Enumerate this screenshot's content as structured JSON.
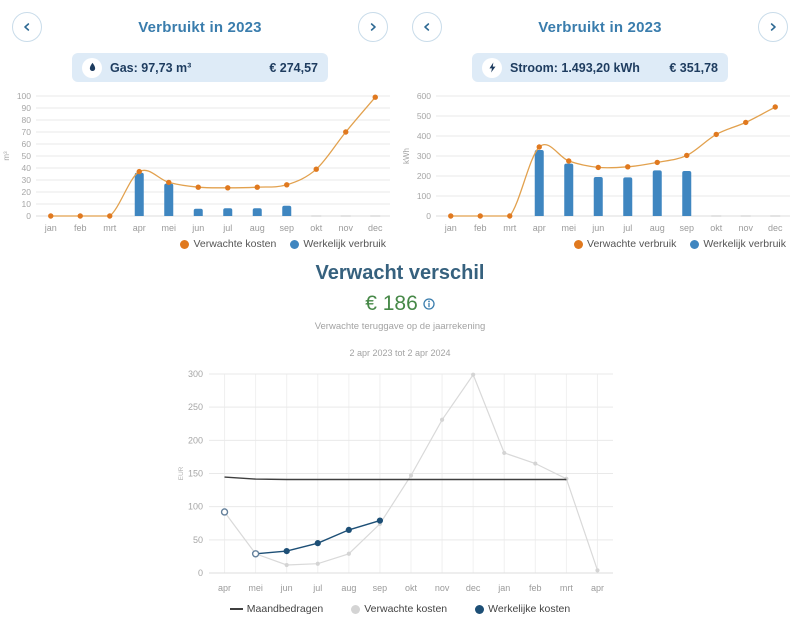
{
  "colors": {
    "accent_blue": "#3a7dad",
    "navy_text": "#1e3c5f",
    "pill_bg": "#deebf7",
    "bar_blue": "#3f86c0",
    "line_orange": "#e2a14e",
    "marker_orange": "#e0791f",
    "green_amount": "#468847",
    "gray_series": "#d9d9d9",
    "navy_series": "#1d4f76",
    "dark_line": "#3f3f3f"
  },
  "gas_panel": {
    "title": "Verbruikt in 2023",
    "pill": {
      "icon": "flame-icon",
      "label": "Gas: 97,73 m³",
      "amount": "€ 274,57"
    },
    "legend": [
      {
        "label": "Verwachte kosten",
        "color": "#e0791f"
      },
      {
        "label": "Werkelijk verbruik",
        "color": "#3f86c0"
      }
    ]
  },
  "stroom_panel": {
    "title": "Verbruikt in 2023",
    "pill": {
      "icon": "lightning-icon",
      "label": "Stroom: 1.493,20 kWh",
      "amount": "€ 351,78"
    },
    "legend": [
      {
        "label": "Verwachte verbruik",
        "color": "#e0791f"
      },
      {
        "label": "Werkelijk verbruik",
        "color": "#3f86c0"
      }
    ]
  },
  "forecast_panel": {
    "title": "Verwacht verschil",
    "amount": "€ 186",
    "subtitle": "Verwachte teruggave op de jaarrekening",
    "date_range": "2 apr 2023 tot 2 apr 2024",
    "legend": [
      {
        "label": "Maandbedragen",
        "color": "#3f3f3f",
        "marker": "line"
      },
      {
        "label": "Verwachte kosten",
        "color": "#d4d4d4",
        "marker": "dot"
      },
      {
        "label": "Werkelijke kosten",
        "color": "#1d4f76",
        "marker": "dot"
      }
    ]
  },
  "chart_data": [
    {
      "id": "gas",
      "type": "bar+line",
      "title": "Gas verbruik 2023",
      "categories": [
        "jan",
        "feb",
        "mrt",
        "apr",
        "mei",
        "jun",
        "jul",
        "aug",
        "sep",
        "okt",
        "nov",
        "dec"
      ],
      "ylabel": "m³",
      "ylim": [
        0,
        100
      ],
      "ystep": 10,
      "grid": true,
      "legend_position": "bottom-right",
      "series": [
        {
          "name": "Verwachte kosten",
          "type": "line",
          "color": "#e2a14e",
          "marker_color": "#e0791f",
          "values": [
            0,
            0,
            0,
            37,
            28,
            24,
            23.5,
            24,
            26,
            39,
            70,
            99
          ]
        },
        {
          "name": "Werkelijk verbruik",
          "type": "bar",
          "color": "#3f86c0",
          "values": [
            0,
            0,
            0,
            36,
            27,
            6,
            6.5,
            6.5,
            8.5,
            null,
            null,
            null
          ]
        }
      ]
    },
    {
      "id": "stroom",
      "type": "bar+line",
      "title": "Stroom verbruik 2023",
      "categories": [
        "jan",
        "feb",
        "mrt",
        "apr",
        "mei",
        "jun",
        "jul",
        "aug",
        "sep",
        "okt",
        "nov",
        "dec"
      ],
      "ylabel": "kWh",
      "ylim": [
        0,
        600
      ],
      "ystep": 100,
      "grid": true,
      "legend_position": "bottom-right",
      "series": [
        {
          "name": "Verwachte verbruik",
          "type": "line",
          "color": "#e2a14e",
          "marker_color": "#e0791f",
          "values": [
            0,
            0,
            0,
            345,
            275,
            243,
            246,
            268,
            303,
            408,
            468,
            545
          ]
        },
        {
          "name": "Werkelijk verbruik",
          "type": "bar",
          "color": "#3f86c0",
          "values": [
            0,
            0,
            0,
            330,
            262,
            195,
            193,
            228,
            225,
            null,
            null,
            null
          ]
        }
      ]
    },
    {
      "id": "forecast",
      "type": "line",
      "title": "Verwacht verschil",
      "categories": [
        "apr",
        "mei",
        "jun",
        "jul",
        "aug",
        "sep",
        "okt",
        "nov",
        "dec",
        "jan",
        "feb",
        "mrt",
        "apr"
      ],
      "ylabel": "EUR",
      "ylim": [
        0,
        300
      ],
      "ystep": 50,
      "grid": true,
      "legend_position": "bottom-center",
      "series": [
        {
          "name": "Maandbedragen",
          "color": "#3f3f3f",
          "values": [
            144.5,
            141.5,
            141,
            141,
            141,
            141,
            141,
            141,
            141,
            141,
            141,
            141
          ]
        },
        {
          "name": "Verwachte kosten",
          "color": "#d9d9d9",
          "marker_color": "#d4d4d4",
          "values": [
            92,
            29,
            12,
            14,
            29,
            74,
            147,
            231,
            299,
            181,
            165,
            142,
            4
          ]
        },
        {
          "name": "Werkelijke kosten",
          "color": "#1d4f76",
          "values": [
            92,
            29,
            33,
            45,
            65,
            79
          ],
          "open_markers": [
            0,
            1
          ]
        }
      ]
    }
  ]
}
